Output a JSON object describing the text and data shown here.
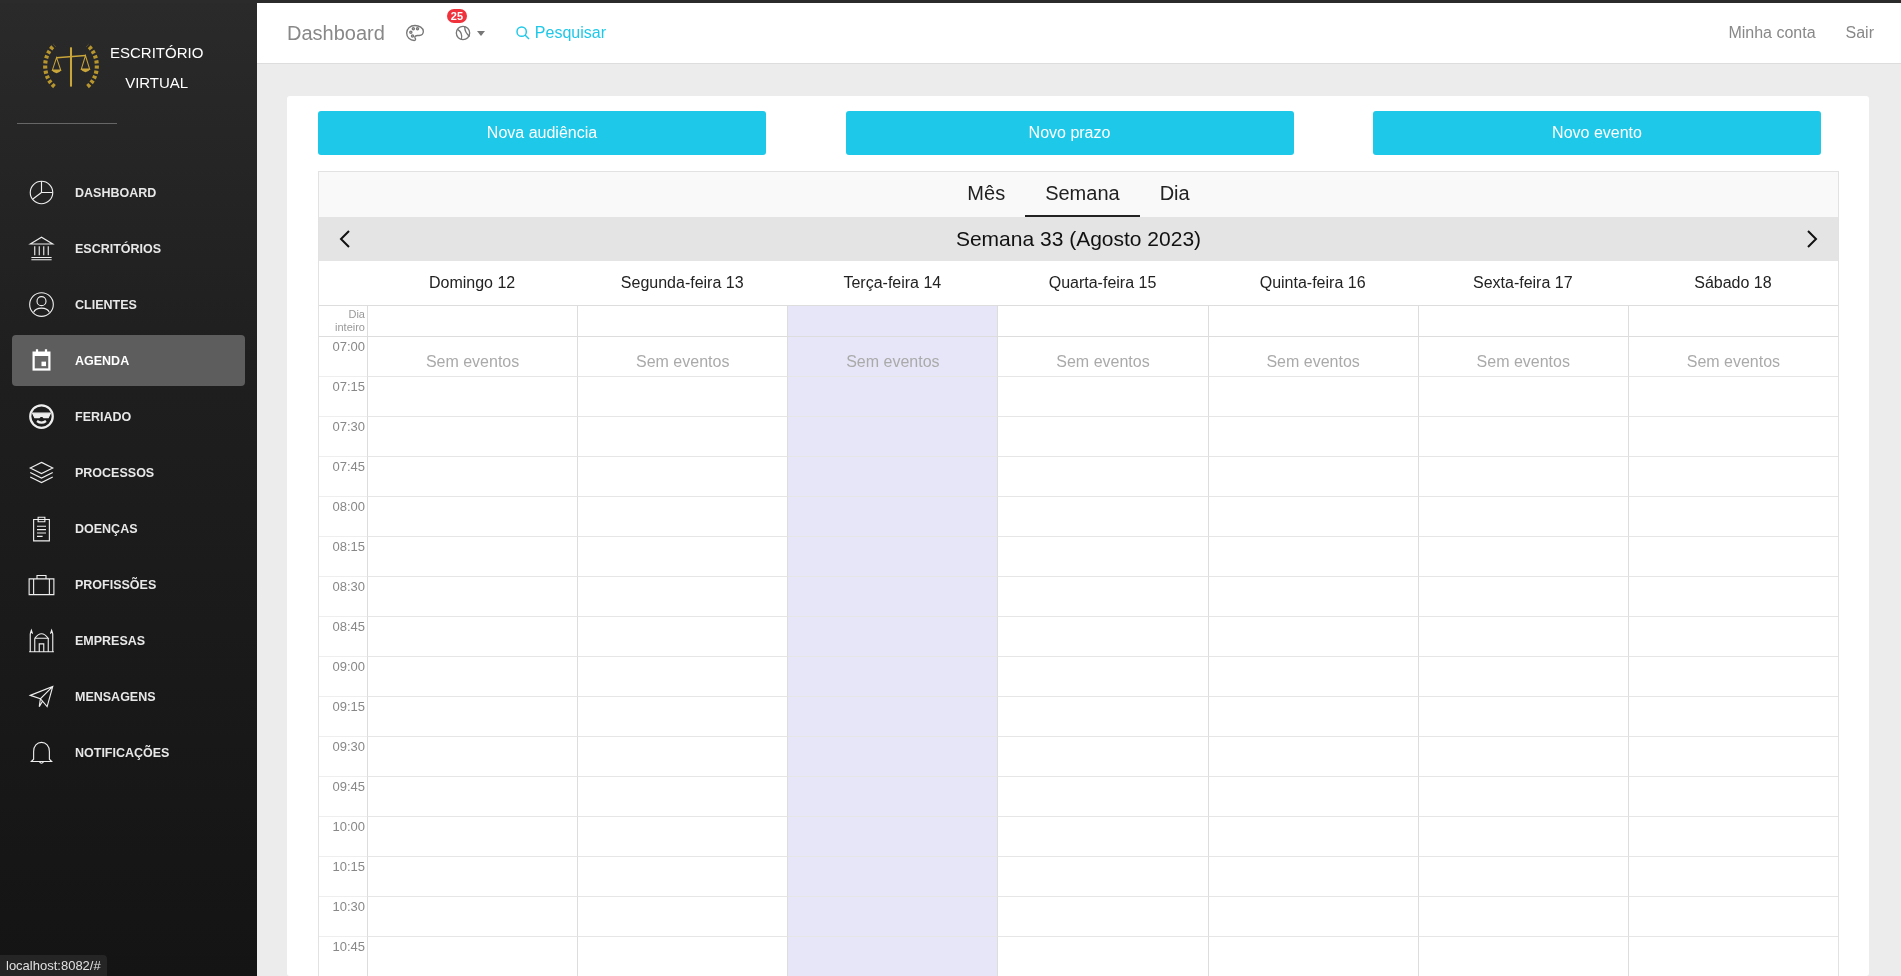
{
  "sidebar": {
    "brand": [
      "ESCRITÓRIO",
      "VIRTUAL"
    ],
    "items": [
      {
        "label": "DASHBOARD",
        "kind": "pie",
        "selected": false
      },
      {
        "label": "ESCRITÓRIOS",
        "kind": "bank",
        "selected": false
      },
      {
        "label": "CLIENTES",
        "kind": "user",
        "selected": false
      },
      {
        "label": "AGENDA",
        "kind": "calendar",
        "selected": true
      },
      {
        "label": "FERIADO",
        "kind": "face",
        "selected": false
      },
      {
        "label": "PROCESSOS",
        "kind": "layers",
        "selected": false
      },
      {
        "label": "DOENÇAS",
        "kind": "clipboard",
        "selected": false
      },
      {
        "label": "PROFISSÕES",
        "kind": "briefcase",
        "selected": false
      },
      {
        "label": "EMPRESAS",
        "kind": "building",
        "selected": false
      },
      {
        "label": "MENSAGENS",
        "kind": "plane",
        "selected": false
      },
      {
        "label": "NOTIFICAÇÕES",
        "kind": "bell",
        "selected": false
      }
    ]
  },
  "topbar": {
    "title": "Dashboard",
    "notification_count": "25",
    "search": "Pesquisar",
    "links": [
      "Minha conta",
      "Sair"
    ]
  },
  "actions": [
    "Nova audiência",
    "Novo prazo",
    "Novo evento"
  ],
  "calendar": {
    "views": [
      {
        "label": "Mês",
        "selected": false
      },
      {
        "label": "Semana",
        "selected": true
      },
      {
        "label": "Dia",
        "selected": false
      }
    ],
    "title": "Semana 33 (Agosto 2023)",
    "all_day_label": "Dia inteiro",
    "days": [
      {
        "label": "Domingo 12",
        "today": false,
        "note": "Sem eventos"
      },
      {
        "label": "Segunda-feira 13",
        "today": false,
        "note": "Sem eventos"
      },
      {
        "label": "Terça-feira 14",
        "today": true,
        "note": "Sem eventos"
      },
      {
        "label": "Quarta-feira 15",
        "today": false,
        "note": "Sem eventos"
      },
      {
        "label": "Quinta-feira 16",
        "today": false,
        "note": "Sem eventos"
      },
      {
        "label": "Sexta-feira 17",
        "today": false,
        "note": "Sem eventos"
      },
      {
        "label": "Sábado 18",
        "today": false,
        "note": "Sem eventos"
      }
    ],
    "times": [
      "07:00",
      "07:15",
      "07:30",
      "07:45",
      "08:00",
      "08:15",
      "08:30",
      "08:45",
      "09:00",
      "09:15",
      "09:30",
      "09:45",
      "10:00",
      "10:15",
      "10:30",
      "10:45"
    ]
  },
  "status_url": "localhost:8082/#"
}
